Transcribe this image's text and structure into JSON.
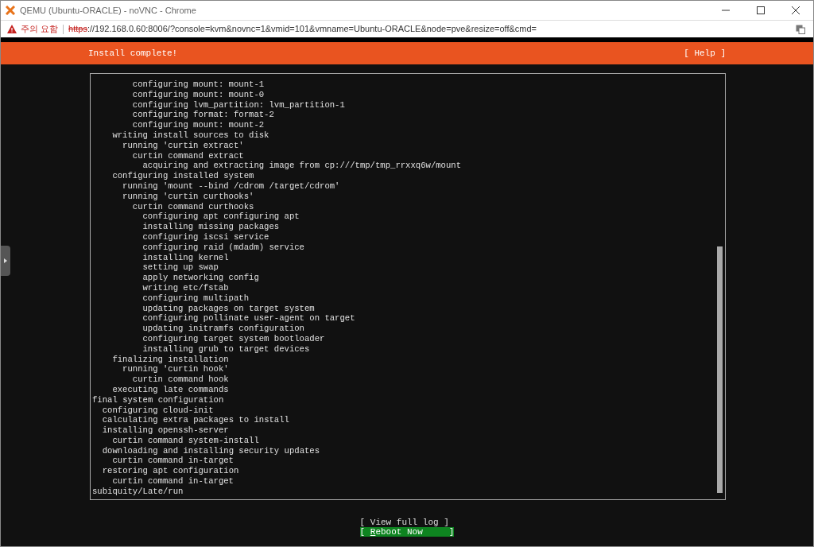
{
  "window": {
    "title": "QEMU (Ubuntu-ORACLE) - noVNC - Chrome"
  },
  "address_bar": {
    "security_warning": "주의 요함",
    "scheme": "https",
    "insecure": true,
    "url_rest": "://192.168.0.60:8006/?console=kvm&novnc=1&vmid=101&vmname=Ubuntu-ORACLE&node=pve&resize=off&cmd="
  },
  "header": {
    "title": "Install complete!",
    "help": "[ Help ]"
  },
  "log": {
    "lines": [
      {
        "children": [
          {
            "children": [
              {
                "children": [
                  {
                    "children": [
                      {
                        "text": "configuring mount: mount-1"
                      },
                      {
                        "text": "configuring mount: mount-0"
                      },
                      {
                        "text": "configuring lvm_partition: lvm_partition-1"
                      },
                      {
                        "text": "configuring format: format-2"
                      },
                      {
                        "text": "configuring mount: mount-2"
                      }
                    ]
                  }
                ]
              },
              {
                "text": "writing install sources to disk",
                "children": [
                  {
                    "text": "running 'curtin extract'",
                    "children": [
                      {
                        "text": "curtin command extract",
                        "children": [
                          {
                            "text": "acquiring and extracting image from cp:///tmp/tmp_rrxxq6w/mount"
                          }
                        ]
                      }
                    ]
                  }
                ]
              },
              {
                "text": "configuring installed system",
                "children": [
                  {
                    "text": "running 'mount --bind /cdrom /target/cdrom'"
                  },
                  {
                    "text": "running 'curtin curthooks'",
                    "children": [
                      {
                        "text": "curtin command curthooks",
                        "children": [
                          {
                            "text": "configuring apt configuring apt"
                          },
                          {
                            "text": "installing missing packages"
                          },
                          {
                            "text": "configuring iscsi service"
                          },
                          {
                            "text": "configuring raid (mdadm) service"
                          },
                          {
                            "text": "installing kernel"
                          },
                          {
                            "text": "setting up swap"
                          },
                          {
                            "text": "apply networking config"
                          },
                          {
                            "text": "writing etc/fstab"
                          },
                          {
                            "text": "configuring multipath"
                          },
                          {
                            "text": "updating packages on target system"
                          },
                          {
                            "text": "configuring pollinate user-agent on target"
                          },
                          {
                            "text": "updating initramfs configuration"
                          },
                          {
                            "text": "configuring target system bootloader"
                          },
                          {
                            "text": "installing grub to target devices"
                          }
                        ]
                      }
                    ]
                  }
                ]
              },
              {
                "text": "finalizing installation",
                "children": [
                  {
                    "text": "running 'curtin hook'",
                    "children": [
                      {
                        "text": "curtin command hook"
                      }
                    ]
                  }
                ]
              },
              {
                "text": "executing late commands"
              }
            ]
          }
        ]
      },
      {
        "text": "final system configuration",
        "children": [
          {
            "text": "configuring cloud-init"
          },
          {
            "text": "calculating extra packages to install"
          },
          {
            "text": "installing openssh-server",
            "children": [
              {
                "text": "curtin command system-install"
              }
            ]
          },
          {
            "text": "downloading and installing security updates",
            "children": [
              {
                "text": "curtin command in-target"
              }
            ]
          },
          {
            "text": "restoring apt configuration",
            "children": [
              {
                "text": "curtin command in-target"
              }
            ]
          }
        ]
      },
      {
        "text": "subiquity/Late/run"
      }
    ]
  },
  "buttons": [
    {
      "label": "[ View full log ]",
      "selected": false
    },
    {
      "label_start": "[ ",
      "hotkey": "R",
      "label": "eboot Now     ]",
      "selected": true
    }
  ]
}
